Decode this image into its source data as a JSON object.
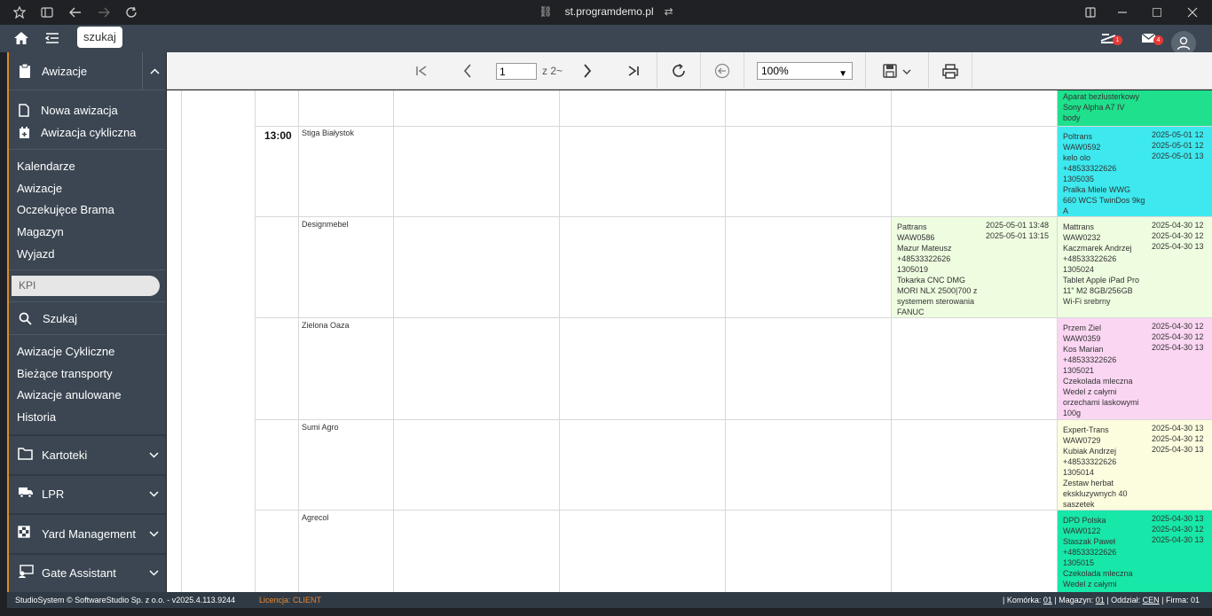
{
  "browser": {
    "url": "st.programdemo.pl"
  },
  "header": {
    "search_label": "szukaj",
    "notif_truck_count": "1",
    "notif_mail_count": "4"
  },
  "sidebar": {
    "section_title": "Awizacje",
    "actions": [
      "Nowa awizacja",
      "Awizacja cykliczna"
    ],
    "links1": [
      "Kalendarze",
      "Awizacje",
      "Oczekujęce Brama",
      "Magazyn",
      "Wyjazd"
    ],
    "kpi": "KPI",
    "search": "Szukaj",
    "links2": [
      "Awizacje Cykliczne",
      "Bieżące transporty",
      "Awizacje anulowane",
      "Historia"
    ],
    "groups": [
      "Kartoteki",
      "LPR",
      "Yard Management",
      "Gate Assistant"
    ]
  },
  "toolbar": {
    "page": "1",
    "page_of": "z 2~",
    "zoom": "100%"
  },
  "report": {
    "time": "13:00",
    "top_cell": [
      "Aparat bezlusterkowy",
      "Sony Alpha A7 IV",
      "body"
    ],
    "rows": [
      {
        "company": "Stiga Białystok",
        "entry": {
          "lines": [
            "Poltrans",
            "WAW0592",
            "kelo olo",
            "+48533322626",
            "1305035",
            "Pralka Miele WWG",
            "660 WCS TwinDos 9kg",
            "A"
          ],
          "dates": [
            "2025-05-01 12",
            "2025-05-01 12",
            "2025-05-01 13"
          ],
          "color": "#3de9ef"
        }
      },
      {
        "company": "Designmebel",
        "mid_entry": {
          "lines": [
            "Pattrans",
            "WAW0586",
            "Mazur Mateusz",
            "+48533322626",
            "1305019",
            "Tokarka CNC DMG",
            "MORI NLX 2500|700 z",
            "systemem sterowania",
            "FANUC"
          ],
          "dates": [
            "2025-05-01 13:48",
            "2025-05-01 13:15"
          ],
          "color": "#eefde0"
        },
        "entry": {
          "lines": [
            "Mattrans",
            "WAW0232",
            "Kaczmarek Andrzej",
            "+48533322626",
            "1305024",
            "Tablet Apple iPad Pro",
            "11\" M2 8GB/256GB",
            "Wi-Fi srebrny"
          ],
          "dates": [
            "2025-04-30 12",
            "2025-04-30 12",
            "2025-04-30 13"
          ],
          "color": "#eefde0"
        }
      },
      {
        "company": "Zielona Oaza",
        "entry": {
          "lines": [
            "Przem Ziel",
            "WAW0359",
            "Kos Marian",
            "+48533322626",
            "1305021",
            "Czekolada mleczna",
            "Wedel z całymi",
            "orzechami laskowymi",
            "100g"
          ],
          "dates": [
            "2025-04-30 12",
            "2025-04-30 12",
            "2025-04-30 13"
          ],
          "color": "#fbd6f3"
        }
      },
      {
        "company": "Sumi Agro",
        "entry": {
          "lines": [
            "Expert-Trans",
            "WAW0729",
            "Kubiak Andrzej",
            "+48533322626",
            "1305014",
            "Zestaw herbat",
            "ekskluzywnych 40",
            "saszetek"
          ],
          "dates": [
            "2025-04-30 13",
            "2025-04-30 12",
            "2025-04-30 13"
          ],
          "color": "#fcfddf"
        }
      },
      {
        "company": "Agrecol",
        "entry": {
          "lines": [
            "DPD Polska",
            "WAW0122",
            "Staszak Paweł",
            "+48533322626",
            "1305015",
            "Czekolada mleczna",
            "Wedel z całymi"
          ],
          "dates": [
            "2025-04-30 13",
            "2025-04-30 12",
            "2025-04-30 13"
          ],
          "color": "#17e7a8"
        }
      }
    ],
    "top_cell_color": "#1fe08c"
  },
  "footer": {
    "copyright": "StudioSystem © SoftwareStudio Sp. z o.o. - v2025.4.113.9244",
    "license": "Licencja: CLIENT",
    "status_prefix": "| Komórka: ",
    "cell_val": "01",
    "mag_label": " | Magazyn: ",
    "mag_val": "01",
    "dept_label": " | Oddział: ",
    "dept_val": "CEN",
    "firm_label": " | Firma: 01"
  }
}
